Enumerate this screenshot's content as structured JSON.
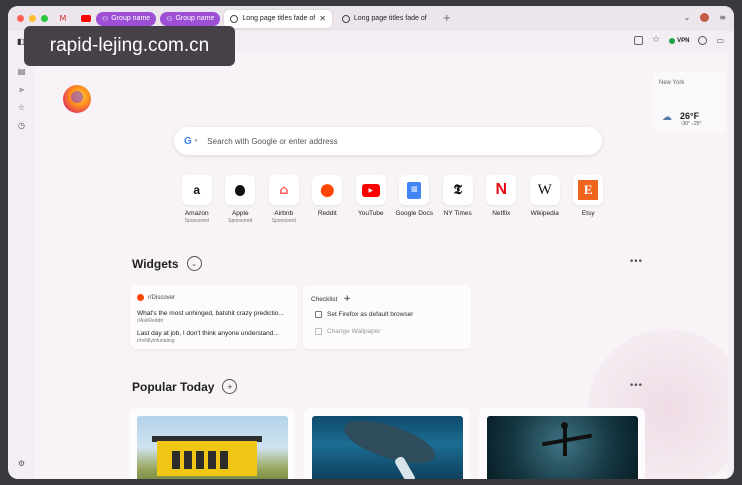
{
  "watermark": "rapid-lejing.com.cn",
  "tabs": {
    "groups": [
      {
        "label": "Group name"
      },
      {
        "label": "Group name"
      }
    ],
    "pages": [
      {
        "label": "Long page titles fade of",
        "active": true
      },
      {
        "label": "Long page titles fade of",
        "active": false
      }
    ]
  },
  "nav": {
    "vpn_label": "VPN"
  },
  "weather": {
    "city": "New York",
    "temp": "26°F",
    "range": "↑30° ↓25°"
  },
  "search": {
    "placeholder": "Search with Google or enter address",
    "engine_icon": "google-icon"
  },
  "shortcuts": [
    {
      "label": "Amazon",
      "sub": "Sponsored",
      "glyph": "a"
    },
    {
      "label": "Apple",
      "sub": "Sponsored",
      "glyph": ""
    },
    {
      "label": "Airbnb",
      "sub": "Sponsored",
      "glyph": "⌂"
    },
    {
      "label": "Reddit",
      "sub": "",
      "glyph": "●"
    },
    {
      "label": "YouTube",
      "sub": "",
      "glyph": "▶"
    },
    {
      "label": "Google Docs",
      "sub": "",
      "glyph": "≡"
    },
    {
      "label": "NY Times",
      "sub": "",
      "glyph": "𝕿"
    },
    {
      "label": "Netflix",
      "sub": "",
      "glyph": "N"
    },
    {
      "label": "Wikipedia",
      "sub": "",
      "glyph": "W"
    },
    {
      "label": "Etsy",
      "sub": "",
      "glyph": "E"
    }
  ],
  "widgets": {
    "title": "Widgets",
    "reddit": {
      "subreddit": "r/Discover",
      "posts": [
        {
          "title": "What's the most unhinged, batshit crazy predictio...",
          "user": "r/AskReddit"
        },
        {
          "title": "Last day at job, I don't think anyone understand...",
          "user": "r/mildlyinfuriating"
        }
      ]
    },
    "checklist": {
      "title": "Checklist",
      "items": [
        {
          "label": "Set Firefox as default browser"
        },
        {
          "label": "Change Wallpaper"
        }
      ]
    }
  },
  "popular": {
    "title": "Popular Today"
  },
  "colors": {
    "group_tab": "#9d4fd6",
    "page_bg": "#f7f3f7"
  }
}
